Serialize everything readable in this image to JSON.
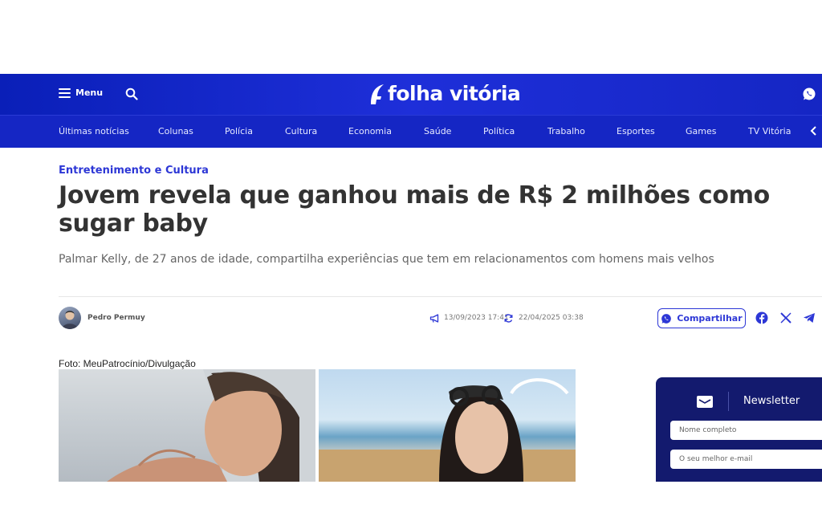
{
  "header": {
    "menu_label": "Menu",
    "logo_text": "folha vitória",
    "brand_color": "#1526c4"
  },
  "icons": {
    "menu": "hamburger-icon",
    "search": "search-icon",
    "whatsapp": "whatsapp-icon",
    "nav_scroll": "chevron-left-icon",
    "published": "megaphone-icon",
    "updated": "refresh-icon",
    "facebook": "facebook-icon",
    "x": "x-icon",
    "telegram": "telegram-icon",
    "newsletter": "mail-icon"
  },
  "nav": {
    "items": [
      "Últimas notícias",
      "Colunas",
      "Polícia",
      "Cultura",
      "Economia",
      "Saúde",
      "Política",
      "Trabalho",
      "Esportes",
      "Games",
      "TV Vitória"
    ]
  },
  "article": {
    "category": "Entretenimento e Cultura",
    "title": "Jovem revela que ganhou mais de R$ 2 milhões como sugar baby",
    "subtitle": "Palmar Kelly, de 27 anos de idade, compartilha experiências que tem em relacionamentos com homens mais velhos",
    "author": "Pedro Permuy",
    "published": "13/09/2023 17:41",
    "updated": "22/04/2025 03:38",
    "share_label": "Compartilhar",
    "photo_caption": "Foto: MeuPatrocínio/Divulgação"
  },
  "newsletter": {
    "title": "Newsletter",
    "name_placeholder": "Nome completo",
    "email_placeholder": "O seu melhor e-mail"
  }
}
